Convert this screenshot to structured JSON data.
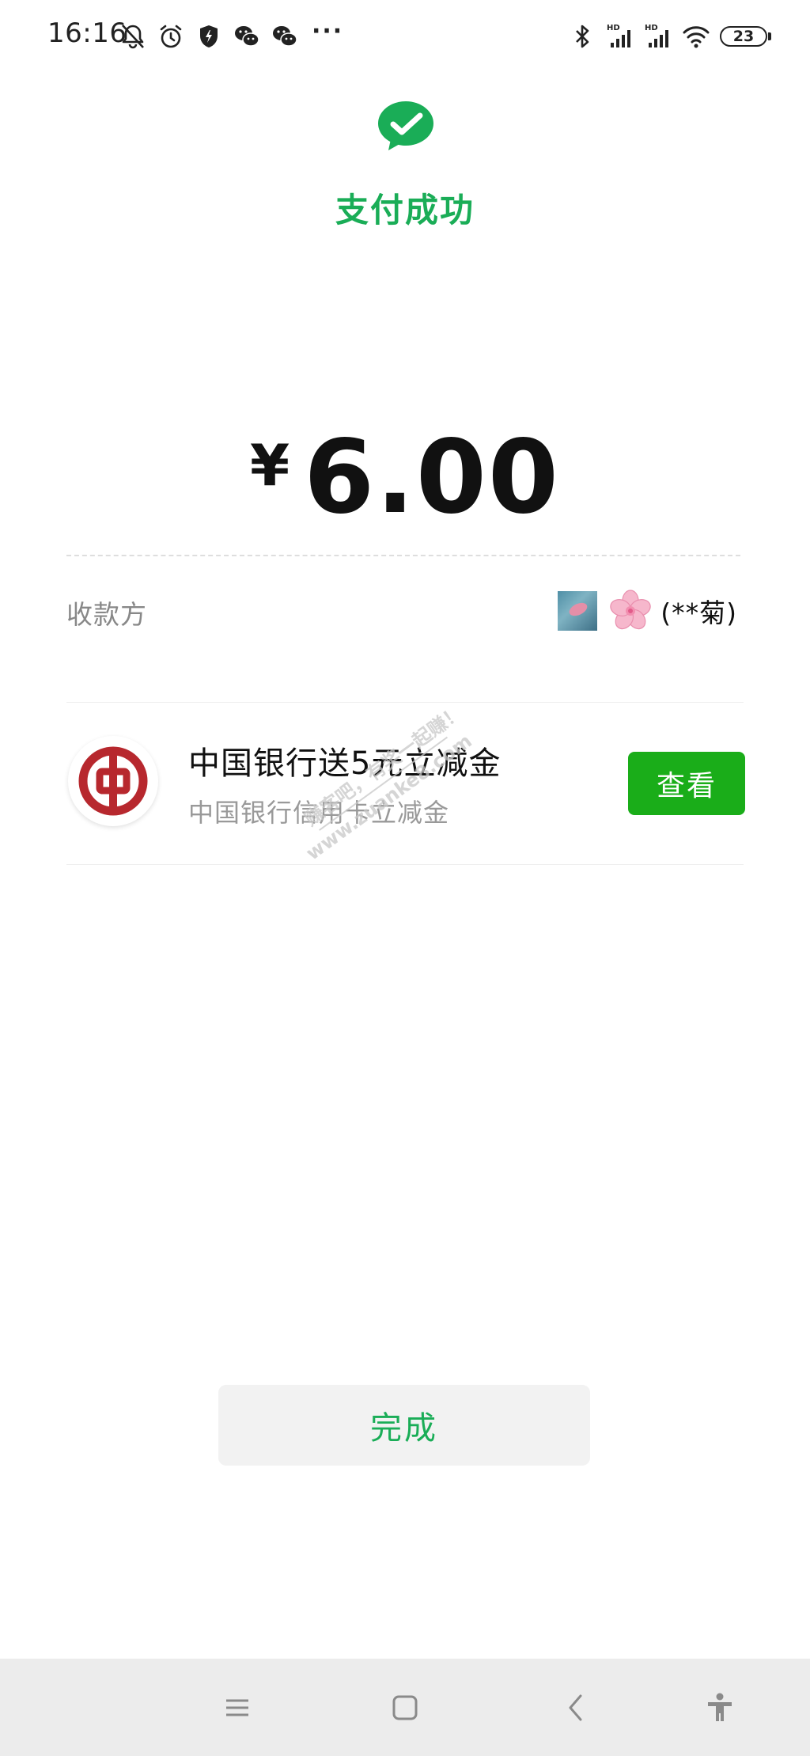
{
  "status_bar": {
    "time": "16:16",
    "battery_level": "23",
    "left_icons": [
      "bell-off-icon",
      "alarm-icon",
      "shield-icon",
      "wechat-icon",
      "wechat-icon"
    ],
    "right_icons": [
      "bluetooth-icon",
      "signal-hd-icon",
      "signal-hd-icon",
      "wifi-icon",
      "battery-icon"
    ],
    "more_indicator": "···",
    "hd_label": "HD"
  },
  "header": {
    "title": "支付成功",
    "icon": "wechat-pay-check-icon"
  },
  "amount": {
    "currency": "¥",
    "value": "6.00"
  },
  "payee": {
    "label": "收款方",
    "name": "(**菊)",
    "flower_emoji": "🌸"
  },
  "promo": {
    "title": "中国银行送5元立减金",
    "subtitle": "中国银行信用卡立减金",
    "button_label": "查看",
    "logo": "bank-of-china-logo"
  },
  "watermark": {
    "line1": "赚客吧，有奖一起赚！",
    "line2": "www.zuanke8.com"
  },
  "footer": {
    "done_label": "完成"
  },
  "nav_bar": {
    "items": [
      "menu-icon",
      "home-icon",
      "back-icon",
      "accessibility-icon"
    ]
  },
  "colors": {
    "accent_green": "#1aad57",
    "button_green": "#1aad19",
    "bank_red": "#b7282e",
    "nav_background": "#ececec"
  }
}
